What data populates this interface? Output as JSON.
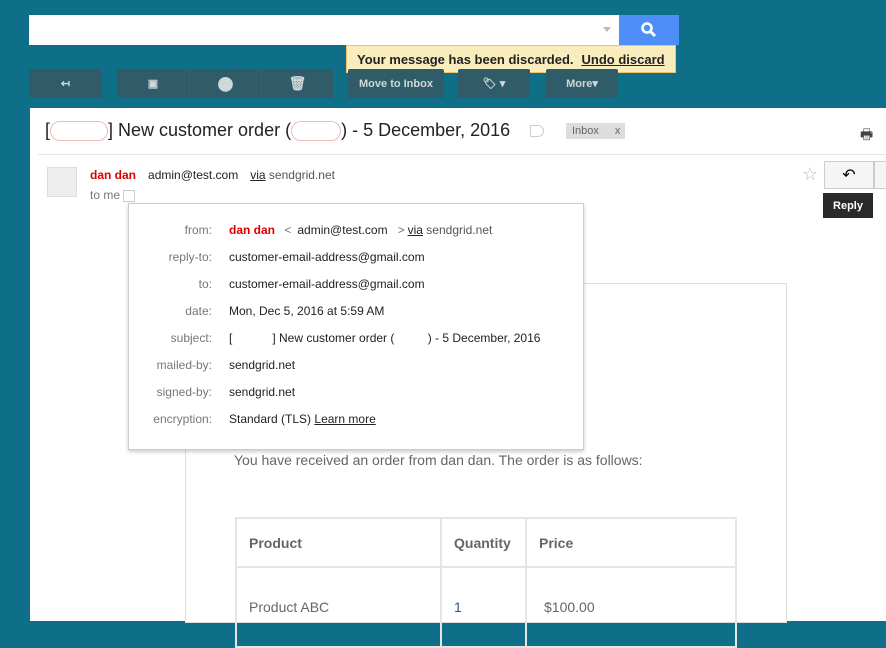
{
  "search": {
    "value": "",
    "icon": "search-icon"
  },
  "toast": {
    "message": "Your message has been discarded.",
    "undo": "Undo discard"
  },
  "toolbar": {
    "move_to_inbox": "Move to Inbox",
    "more": "More"
  },
  "email": {
    "subject_a": "[",
    "subject_b": "] New customer order (",
    "subject_c": ") - 5 December, 2016",
    "label": "Inbox",
    "label_close": "x",
    "sender_name": "dan dan",
    "sender_email": "admin@test.com",
    "via": "via",
    "via_domain": "sendgrid.net",
    "to": "to me",
    "reply_tooltip": "Reply"
  },
  "details": [
    {
      "k": "from:",
      "v": "dan dan"
    },
    {
      "k": "reply-to:",
      "v": "customer-email-address@gmail.com"
    },
    {
      "k": "to:",
      "v": "customer-email-address@gmail.com"
    },
    {
      "k": "date:",
      "v": "Mon, Dec 5, 2016 at 5:59 AM"
    },
    {
      "k": "subject:",
      "v": "[            ] New customer order (          ) - 5 December, 2016"
    },
    {
      "k": "mailed-by:",
      "v": "sendgrid.net"
    },
    {
      "k": "signed-by:",
      "v": "sendgrid.net"
    },
    {
      "k": "encryption:",
      "v": "Standard (TLS)"
    }
  ],
  "from_extra": {
    "lt": "<",
    "email": "admin@test.com",
    "gt": ">",
    "via": "via",
    "domain": "sendgrid.net"
  },
  "learn_more": "Learn more",
  "body": {
    "intro": "You have received an order from dan dan. The order is as follows:",
    "headers": [
      "Product",
      "Quantity",
      "Price"
    ],
    "rows": [
      [
        "Product ABC",
        "1",
        "$100.00"
      ]
    ]
  }
}
